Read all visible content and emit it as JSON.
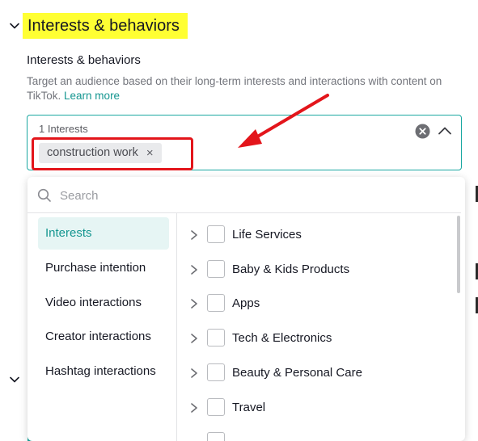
{
  "section": {
    "title": "Interests & behaviors"
  },
  "field": {
    "label": "Interests & behaviors",
    "description": "Target an audience based on their long-term interests and interactions with content on TikTok.",
    "learn_more": "Learn more"
  },
  "selector": {
    "count_label": "1 Interests",
    "tag": {
      "label": "construction work",
      "close_glyph": "×"
    }
  },
  "dropdown": {
    "search_placeholder": "Search",
    "categories": [
      {
        "label": "Interests",
        "active": true
      },
      {
        "label": "Purchase intention",
        "active": false
      },
      {
        "label": "Video interactions",
        "active": false
      },
      {
        "label": "Creator interactions",
        "active": false
      },
      {
        "label": "Hashtag interactions",
        "active": false
      }
    ],
    "options": [
      {
        "label": "Life Services",
        "checked": false
      },
      {
        "label": "Baby & Kids Products",
        "checked": false
      },
      {
        "label": "Apps",
        "checked": false
      },
      {
        "label": "Tech & Electronics",
        "checked": false
      },
      {
        "label": "Beauty & Personal Care",
        "checked": false
      },
      {
        "label": "Travel",
        "checked": false
      }
    ]
  },
  "colors": {
    "accent": "#149690",
    "highlight": "#ffff33",
    "annotation_red": "#e3151b"
  },
  "icons": {
    "section_toggle": "chevron-down-icon",
    "clear": "clear-circle-icon",
    "collapse": "chevron-up-icon",
    "search": "search-icon",
    "expand": "chevron-right-icon"
  }
}
